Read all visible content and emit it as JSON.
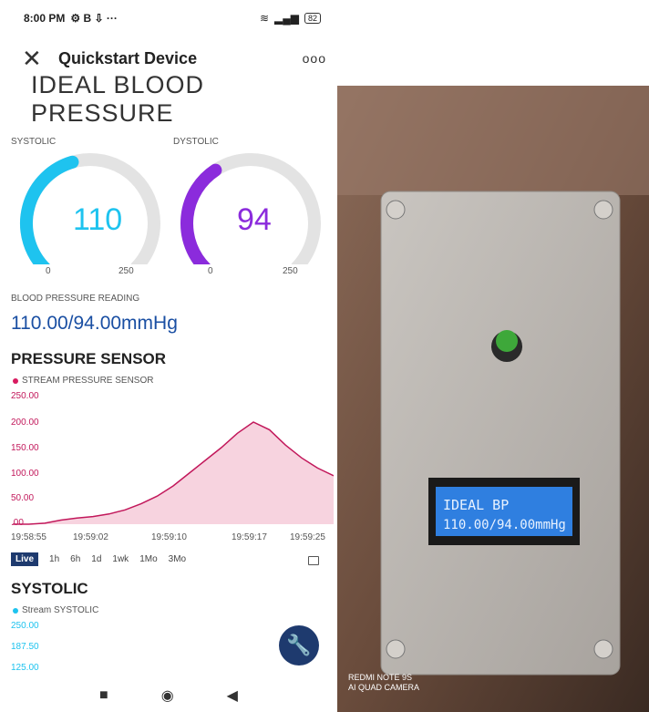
{
  "status": {
    "time": "8:00 PM",
    "icons_left": "⚙ B ⇩ ···",
    "battery": "82"
  },
  "appbar": {
    "title": "Quickstart Device",
    "more": "ooo"
  },
  "top_heading": "IDEAL BLOOD PRESSURE",
  "gauges": [
    {
      "label": "SYSTOLIC",
      "value": "110",
      "min": "0",
      "max": "250",
      "color": "#1ec3ef",
      "fraction": 0.44
    },
    {
      "label": "DYSTOLIC",
      "value": "94",
      "min": "0",
      "max": "250",
      "color": "#8b2bdc",
      "fraction": 0.376
    }
  ],
  "bp": {
    "label": "BLOOD PRESSURE READING",
    "value": "110.00/94.00mmHg"
  },
  "pressure_chart": {
    "title": "PRESSURE SENSOR",
    "legend": "STREAM PRESSURE SENSOR",
    "legend_color": "#d81b60",
    "y_ticks": [
      "250.00",
      "200.00",
      "150.00",
      "100.00",
      "50.00",
      ".00"
    ],
    "x_ticks": [
      "19:58:55",
      "19:59:02",
      "19:59:10",
      "19:59:17",
      "19:59:25"
    ]
  },
  "chart_data": {
    "type": "area",
    "title": "PRESSURE SENSOR",
    "series": [
      {
        "name": "STREAM PRESSURE SENSOR",
        "values": [
          0,
          0,
          2,
          8,
          12,
          15,
          20,
          28,
          40,
          55,
          75,
          100,
          125,
          150,
          178,
          200,
          185,
          155,
          130,
          110,
          95
        ]
      }
    ],
    "x_range": [
      "19:58:55",
      "19:59:25"
    ],
    "ylim": [
      0,
      250
    ]
  },
  "range": {
    "options": [
      "Live",
      "1h",
      "6h",
      "1d",
      "1wk",
      "1Mo",
      "3Mo"
    ]
  },
  "systolic_chart": {
    "title": "SYSTOLIC",
    "legend": "Stream SYSTOLIC",
    "legend_color": "#1ec3ef",
    "y_ticks": [
      "250.00",
      "187.50",
      "125.00"
    ]
  },
  "nav": {
    "square": "■",
    "circle": "◉",
    "back": "◀"
  },
  "photo": {
    "lcd_line1": "IDEAL BP",
    "lcd_line2": "110.00/94.00mmHg",
    "watermark_line1": "REDMI NOTE 9S",
    "watermark_line2": "AI QUAD CAMERA"
  }
}
